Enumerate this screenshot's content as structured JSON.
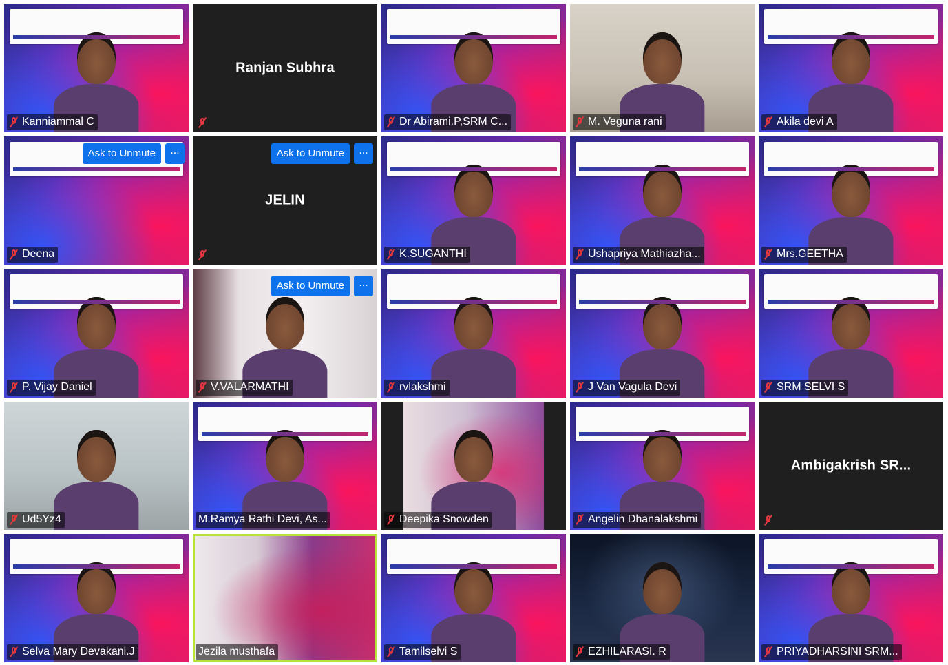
{
  "gallery": {
    "tiles": [
      {
        "name": "Kanniammal C",
        "bg": "banner",
        "person": true,
        "muted": true
      },
      {
        "name": "Ranjan Subhra",
        "bg": "blank",
        "person": false,
        "muted": true,
        "center_name": true
      },
      {
        "name": "Dr Abirami.P,SRM C...",
        "bg": "banner",
        "person": true,
        "muted": true
      },
      {
        "name": "M. Veguna rani",
        "bg": "room",
        "person": true,
        "muted": true
      },
      {
        "name": "Akila devi A",
        "bg": "banner",
        "person": true,
        "muted": true
      },
      {
        "name": "Deena",
        "bg": "banner",
        "person": false,
        "muted": true,
        "ask_to_unmute": true
      },
      {
        "name": "JELIN",
        "bg": "blank",
        "person": false,
        "muted": true,
        "center_name": true,
        "ask_to_unmute": true
      },
      {
        "name": "K.SUGANTHI",
        "bg": "banner",
        "person": true,
        "muted": true
      },
      {
        "name": "Ushapriya Mathiazha...",
        "bg": "banner",
        "person": true,
        "muted": true
      },
      {
        "name": "Mrs.GEETHA",
        "bg": "banner",
        "person": true,
        "muted": true
      },
      {
        "name": "P. Vijay Daniel",
        "bg": "banner",
        "person": true,
        "muted": true
      },
      {
        "name": "V.VALARMATHI",
        "bg": "curtain",
        "person": true,
        "muted": true,
        "ask_to_unmute": true
      },
      {
        "name": "rvlakshmi",
        "bg": "banner",
        "person": true,
        "muted": true
      },
      {
        "name": "J Van Vagula Devi",
        "bg": "banner",
        "person": true,
        "muted": true
      },
      {
        "name": "SRM SELVI S",
        "bg": "banner",
        "person": true,
        "muted": true
      },
      {
        "name": "Ud5Yz4",
        "bg": "office",
        "person": true,
        "muted": true
      },
      {
        "name": "M.Ramya Rathi Devi, As...",
        "bg": "banner",
        "person": true,
        "muted": false
      },
      {
        "name": "Deepika Snowden",
        "bg": "letterbox",
        "person": true,
        "muted": true
      },
      {
        "name": "Angelin Dhanalakshmi",
        "bg": "banner",
        "person": true,
        "muted": true
      },
      {
        "name": "Ambigakrish  SR...",
        "bg": "blank",
        "person": false,
        "muted": true,
        "center_name": true
      },
      {
        "name": "Selva Mary Devakani.J",
        "bg": "banner",
        "person": true,
        "muted": true
      },
      {
        "name": "Jezila musthafa",
        "bg": "lace",
        "person": false,
        "muted": false,
        "active": true
      },
      {
        "name": "Tamilselvi S",
        "bg": "banner",
        "person": true,
        "muted": true
      },
      {
        "name": "EZHILARASI. R",
        "bg": "space",
        "person": true,
        "muted": true
      },
      {
        "name": "PRIYADHARSINI SRM...",
        "bg": "banner",
        "person": true,
        "muted": true
      }
    ]
  },
  "labels": {
    "ask_to_unmute": "Ask to Unmute",
    "more": "···"
  },
  "colors": {
    "zoom_blue": "#0e72ed",
    "muted_red": "#e0383e",
    "active_speaker": "#b7e23a",
    "tile_blank": "#1f1f1f"
  },
  "icons": {
    "muted": "microphone-muted-icon",
    "more": "more-options-icon"
  }
}
